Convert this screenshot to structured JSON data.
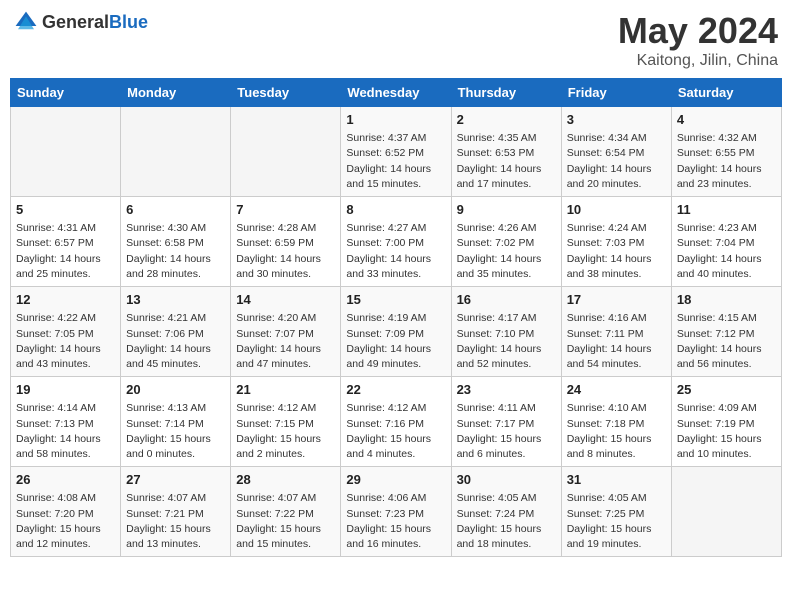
{
  "header": {
    "logo_general": "General",
    "logo_blue": "Blue",
    "month_title": "May 2024",
    "location": "Kaitong, Jilin, China"
  },
  "weekdays": [
    "Sunday",
    "Monday",
    "Tuesday",
    "Wednesday",
    "Thursday",
    "Friday",
    "Saturday"
  ],
  "weeks": [
    [
      {
        "day": "",
        "detail": ""
      },
      {
        "day": "",
        "detail": ""
      },
      {
        "day": "",
        "detail": ""
      },
      {
        "day": "1",
        "detail": "Sunrise: 4:37 AM\nSunset: 6:52 PM\nDaylight: 14 hours\nand 15 minutes."
      },
      {
        "day": "2",
        "detail": "Sunrise: 4:35 AM\nSunset: 6:53 PM\nDaylight: 14 hours\nand 17 minutes."
      },
      {
        "day": "3",
        "detail": "Sunrise: 4:34 AM\nSunset: 6:54 PM\nDaylight: 14 hours\nand 20 minutes."
      },
      {
        "day": "4",
        "detail": "Sunrise: 4:32 AM\nSunset: 6:55 PM\nDaylight: 14 hours\nand 23 minutes."
      }
    ],
    [
      {
        "day": "5",
        "detail": "Sunrise: 4:31 AM\nSunset: 6:57 PM\nDaylight: 14 hours\nand 25 minutes."
      },
      {
        "day": "6",
        "detail": "Sunrise: 4:30 AM\nSunset: 6:58 PM\nDaylight: 14 hours\nand 28 minutes."
      },
      {
        "day": "7",
        "detail": "Sunrise: 4:28 AM\nSunset: 6:59 PM\nDaylight: 14 hours\nand 30 minutes."
      },
      {
        "day": "8",
        "detail": "Sunrise: 4:27 AM\nSunset: 7:00 PM\nDaylight: 14 hours\nand 33 minutes."
      },
      {
        "day": "9",
        "detail": "Sunrise: 4:26 AM\nSunset: 7:02 PM\nDaylight: 14 hours\nand 35 minutes."
      },
      {
        "day": "10",
        "detail": "Sunrise: 4:24 AM\nSunset: 7:03 PM\nDaylight: 14 hours\nand 38 minutes."
      },
      {
        "day": "11",
        "detail": "Sunrise: 4:23 AM\nSunset: 7:04 PM\nDaylight: 14 hours\nand 40 minutes."
      }
    ],
    [
      {
        "day": "12",
        "detail": "Sunrise: 4:22 AM\nSunset: 7:05 PM\nDaylight: 14 hours\nand 43 minutes."
      },
      {
        "day": "13",
        "detail": "Sunrise: 4:21 AM\nSunset: 7:06 PM\nDaylight: 14 hours\nand 45 minutes."
      },
      {
        "day": "14",
        "detail": "Sunrise: 4:20 AM\nSunset: 7:07 PM\nDaylight: 14 hours\nand 47 minutes."
      },
      {
        "day": "15",
        "detail": "Sunrise: 4:19 AM\nSunset: 7:09 PM\nDaylight: 14 hours\nand 49 minutes."
      },
      {
        "day": "16",
        "detail": "Sunrise: 4:17 AM\nSunset: 7:10 PM\nDaylight: 14 hours\nand 52 minutes."
      },
      {
        "day": "17",
        "detail": "Sunrise: 4:16 AM\nSunset: 7:11 PM\nDaylight: 14 hours\nand 54 minutes."
      },
      {
        "day": "18",
        "detail": "Sunrise: 4:15 AM\nSunset: 7:12 PM\nDaylight: 14 hours\nand 56 minutes."
      }
    ],
    [
      {
        "day": "19",
        "detail": "Sunrise: 4:14 AM\nSunset: 7:13 PM\nDaylight: 14 hours\nand 58 minutes."
      },
      {
        "day": "20",
        "detail": "Sunrise: 4:13 AM\nSunset: 7:14 PM\nDaylight: 15 hours\nand 0 minutes."
      },
      {
        "day": "21",
        "detail": "Sunrise: 4:12 AM\nSunset: 7:15 PM\nDaylight: 15 hours\nand 2 minutes."
      },
      {
        "day": "22",
        "detail": "Sunrise: 4:12 AM\nSunset: 7:16 PM\nDaylight: 15 hours\nand 4 minutes."
      },
      {
        "day": "23",
        "detail": "Sunrise: 4:11 AM\nSunset: 7:17 PM\nDaylight: 15 hours\nand 6 minutes."
      },
      {
        "day": "24",
        "detail": "Sunrise: 4:10 AM\nSunset: 7:18 PM\nDaylight: 15 hours\nand 8 minutes."
      },
      {
        "day": "25",
        "detail": "Sunrise: 4:09 AM\nSunset: 7:19 PM\nDaylight: 15 hours\nand 10 minutes."
      }
    ],
    [
      {
        "day": "26",
        "detail": "Sunrise: 4:08 AM\nSunset: 7:20 PM\nDaylight: 15 hours\nand 12 minutes."
      },
      {
        "day": "27",
        "detail": "Sunrise: 4:07 AM\nSunset: 7:21 PM\nDaylight: 15 hours\nand 13 minutes."
      },
      {
        "day": "28",
        "detail": "Sunrise: 4:07 AM\nSunset: 7:22 PM\nDaylight: 15 hours\nand 15 minutes."
      },
      {
        "day": "29",
        "detail": "Sunrise: 4:06 AM\nSunset: 7:23 PM\nDaylight: 15 hours\nand 16 minutes."
      },
      {
        "day": "30",
        "detail": "Sunrise: 4:05 AM\nSunset: 7:24 PM\nDaylight: 15 hours\nand 18 minutes."
      },
      {
        "day": "31",
        "detail": "Sunrise: 4:05 AM\nSunset: 7:25 PM\nDaylight: 15 hours\nand 19 minutes."
      },
      {
        "day": "",
        "detail": ""
      }
    ]
  ]
}
